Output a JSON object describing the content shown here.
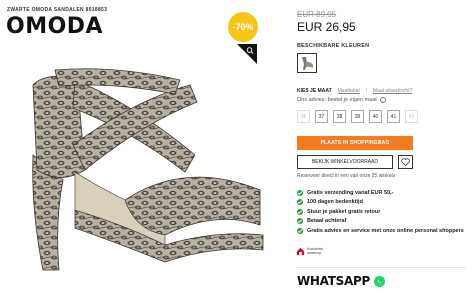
{
  "product": {
    "subtitle": "ZWARTE OMODA SANDALEN 8018853",
    "brand": "OMODA",
    "discount_badge": "-70%"
  },
  "price": {
    "old": "EUR 89,95",
    "new": "EUR 26,95"
  },
  "color": {
    "label": "BESCHIKBARE KLEUREN"
  },
  "size": {
    "label": "KIES JE MAAT",
    "size_table_link": "Maattabel",
    "size_advice_link": "Maat uitverkocht?",
    "advice_text": "Ons advies: bestel je eigen maat",
    "info_icon": "i",
    "options": [
      {
        "label": "36",
        "available": false
      },
      {
        "label": "37",
        "available": true
      },
      {
        "label": "38",
        "available": true
      },
      {
        "label": "39",
        "available": true
      },
      {
        "label": "40",
        "available": true
      },
      {
        "label": "41",
        "available": true
      },
      {
        "label": "42",
        "available": false
      }
    ]
  },
  "actions": {
    "cart_label": "PLAATS IN SHOPPINGBAG",
    "store_label": "BEKIJK WINKELVOORRAAD",
    "reserve_text": "Reserveer direct in een van onze 25 winkels"
  },
  "usps": [
    "Gratis verzending vanaf EUR 50,-",
    "100 dagen bedenktijd",
    "Stuur je pakket gratis retour",
    "Betaal achteraf",
    "Gratis advies en service met onze online personal shoppers"
  ],
  "trust": {
    "text": "thuiswinkel waarborg"
  },
  "whatsapp": {
    "label": "WHATSAPP"
  },
  "colors": {
    "accent": "#f47b20",
    "badge": "#f5c518",
    "check": "#2e9b3a",
    "whatsapp": "#25d366"
  }
}
